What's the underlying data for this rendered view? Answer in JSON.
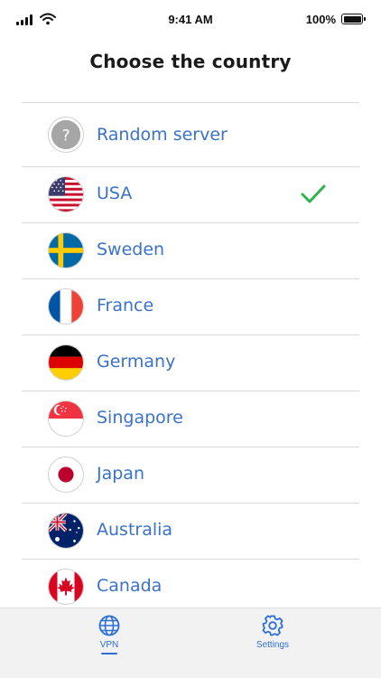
{
  "status_bar": {
    "time": "9:41 AM",
    "battery": "100%"
  },
  "page_title": "Choose the country",
  "countries": [
    {
      "name": "Random server",
      "flag_icon": "random-server-icon",
      "selected": false
    },
    {
      "name": "USA",
      "flag_icon": "usa-flag-icon",
      "selected": true
    },
    {
      "name": "Sweden",
      "flag_icon": "sweden-flag-icon",
      "selected": false
    },
    {
      "name": "France",
      "flag_icon": "france-flag-icon",
      "selected": false
    },
    {
      "name": "Germany",
      "flag_icon": "germany-flag-icon",
      "selected": false
    },
    {
      "name": "Singapore",
      "flag_icon": "singapore-flag-icon",
      "selected": false
    },
    {
      "name": "Japan",
      "flag_icon": "japan-flag-icon",
      "selected": false
    },
    {
      "name": "Australia",
      "flag_icon": "australia-flag-icon",
      "selected": false
    },
    {
      "name": "Canada",
      "flag_icon": "canada-flag-icon",
      "selected": false
    }
  ],
  "tab_bar": {
    "tabs": [
      {
        "label": "VPN",
        "icon": "globe-icon",
        "active": true
      },
      {
        "label": "Settings",
        "icon": "gear-icon",
        "active": false
      }
    ]
  },
  "colors": {
    "accent": "#2b6fd6",
    "country_text": "#3a72c9",
    "check": "#2fb24a",
    "tab_bg": "#f2f2f2"
  }
}
